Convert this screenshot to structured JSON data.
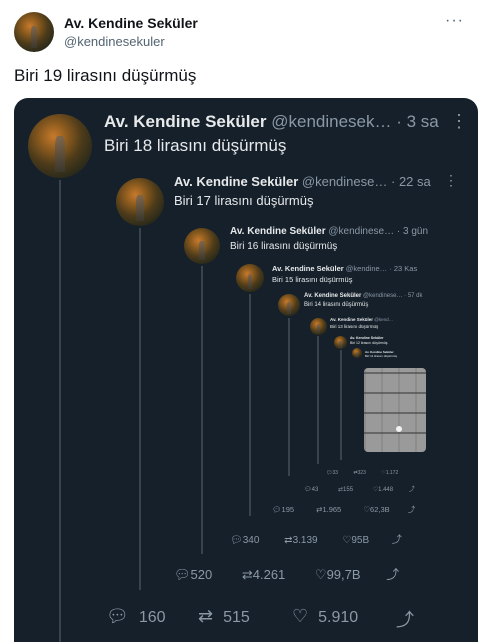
{
  "author": {
    "name": "Av. Kendine Seküler",
    "handle": "@kendinesekuler",
    "handle_trunc": "@kendinesek…",
    "more": "···"
  },
  "tweet_text": "Biri 19 lirasını düşürmüş",
  "nested": [
    {
      "text": "Biri 18 lirasını düşürmüş",
      "time": "3 sa",
      "handle": "@kendinesek…",
      "replies": "160",
      "retweets": "515",
      "likes": "5.910"
    },
    {
      "text": "Biri 17 lirasını düşürmüş",
      "time": "22 sa",
      "handle": "@kendinese…",
      "replies": "520",
      "retweets": "4.261",
      "likes": "99,7B"
    },
    {
      "text": "Biri 16 lirasını düşürmüş",
      "time": "3 gün",
      "handle": "@kendinese…",
      "replies": "340",
      "retweets": "3.139",
      "likes": "95B"
    },
    {
      "text": "Biri 15 lirasını düşürmüş",
      "time": "23 Kas",
      "handle": "@kendine…",
      "replies": "195",
      "retweets": "1.965",
      "likes": "62,3B"
    },
    {
      "text": "Biri 14 lirasını düşürmüş",
      "time": "57 dk",
      "handle": "@kendinese…",
      "replies": "43",
      "retweets": "155",
      "likes": "1.448"
    },
    {
      "text": "Biri 13 lirasını düşürmüş",
      "time": "",
      "handle": "@kend…",
      "replies": "33",
      "retweets": "323",
      "likes": "1.172"
    },
    {
      "text": "Biri 12 lirasını düşürmüş",
      "time": "",
      "handle": "",
      "replies": "",
      "retweets": "",
      "likes": ""
    },
    {
      "text": "Biri 11 lirasını düşürmüş",
      "time": "",
      "handle": "",
      "replies": "",
      "retweets": "",
      "likes": ""
    }
  ],
  "icons": {
    "reply": "reply-icon",
    "retweet": "retweet-icon",
    "like": "heart-icon",
    "share": "share-icon"
  }
}
